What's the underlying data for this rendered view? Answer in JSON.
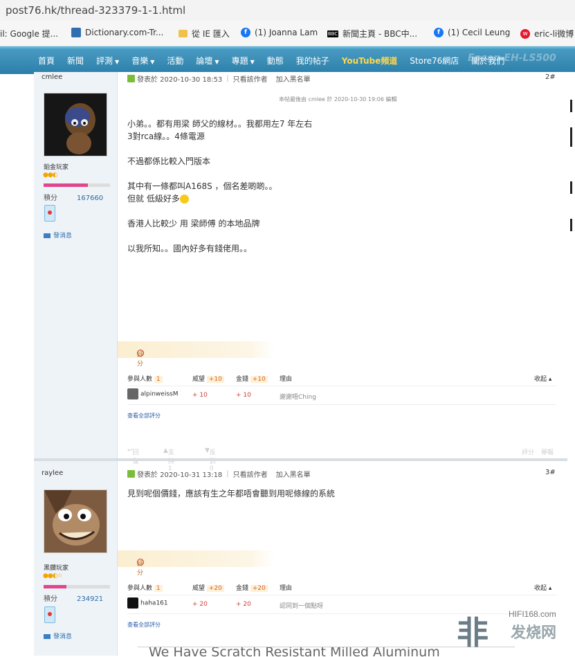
{
  "browser": {
    "url": "post76.hk/thread-323379-1-1.html",
    "bookmarks": [
      {
        "label": "il: Google 提...",
        "icon": "none"
      },
      {
        "label": "Dictionary.com-Tr...",
        "icon": "dictionary-icon"
      },
      {
        "label": "從 IE 匯入",
        "icon": "folder-icon"
      },
      {
        "label": "(1) Joanna Lam",
        "icon": "facebook-icon"
      },
      {
        "label": "新聞主頁 - BBC中...",
        "icon": "bbc-icon"
      },
      {
        "label": "(1) Cecil Leung",
        "icon": "facebook-icon"
      },
      {
        "label": "eric-li微博",
        "icon": "weibo-icon"
      }
    ]
  },
  "nav": {
    "items": [
      {
        "label": "首頁"
      },
      {
        "label": "新聞"
      },
      {
        "label": "評測",
        "dropdown": true
      },
      {
        "label": "音樂",
        "dropdown": true
      },
      {
        "label": "活動"
      },
      {
        "label": "論壇",
        "dropdown": true
      },
      {
        "label": "專題",
        "dropdown": true
      },
      {
        "label": "動態"
      },
      {
        "label": "我的帖子"
      },
      {
        "label": "YouTube頻道",
        "highlight": true
      },
      {
        "label": "Store76網店"
      },
      {
        "label": "關於我們"
      }
    ],
    "banner_brand": "Epson EH-LS500",
    "highlight_color": "#ffd84a"
  },
  "posts": [
    {
      "username": "cmlee",
      "rank": "鉑金玩家",
      "points_label": "積分",
      "points": "167660",
      "message_label": "發消息",
      "header": {
        "posted": "發表於 2020-10-30 18:53",
        "only_author": "只看該作者",
        "blacklist": "加入黑名單",
        "floor": "2#"
      },
      "edit_note": "本帖最後由 cmlee 於 2020-10-30 19:06 編輯",
      "lines": [
        "小弟。。都有用梁 師父的線材。。我都用左7 年左右",
        "3對rca線。。4條電源",
        "",
        "不過都係比較入門版本",
        "",
        "其中有一條都叫A168S ，個名差啲啲。。",
        "但就 低級好多",
        "",
        "香港人比較少 用 梁師傅 的本地品牌",
        "",
        "以我所知。。國內好多有錢佬用。。"
      ],
      "rate_label": "評分",
      "rating": {
        "headers": [
          "參與人數",
          "1",
          "威望",
          "+10",
          "金錢",
          "+10",
          "理由",
          "收起"
        ],
        "row": {
          "user": "alpinweissM",
          "rep": "+ 10",
          "money": "+ 10",
          "reason": "謝謝唔Ching"
        }
      },
      "view_all": "查看全部評分",
      "actions": [
        "回復",
        "支持 1",
        "反對 0",
        "評分",
        "舉報"
      ]
    },
    {
      "username": "raylee",
      "rank": "黑鑽玩家",
      "points_label": "積分",
      "points": "234921",
      "message_label": "發消息",
      "header": {
        "posted": "發表於 2020-10-31 13:18",
        "only_author": "只看該作者",
        "blacklist": "加入黑名單",
        "floor": "3#"
      },
      "lines": [
        "見到呢個價錢，應該有生之年都唔會聽到用呢條線的系統"
      ],
      "rate_label": "評分",
      "rating": {
        "headers": [
          "參與人數",
          "1",
          "威望",
          "+20",
          "金錢",
          "+20",
          "理由",
          "收起"
        ],
        "row": {
          "user": "haha161",
          "rep": "+ 20",
          "money": "+ 20",
          "reason": "認同到一個點呀"
        }
      },
      "view_all": "查看全部評分"
    }
  ],
  "watermark": {
    "site": "HIFI168.com",
    "cn": "发烧网"
  },
  "ad_text": "We Have Scratch Resistant Milled Aluminum"
}
